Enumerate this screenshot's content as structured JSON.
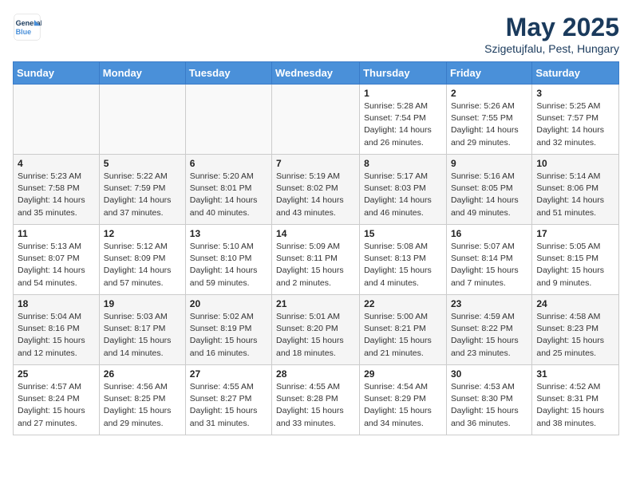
{
  "header": {
    "logo_line1": "General",
    "logo_line2": "Blue",
    "month": "May 2025",
    "location": "Szigetujfalu, Pest, Hungary"
  },
  "days_of_week": [
    "Sunday",
    "Monday",
    "Tuesday",
    "Wednesday",
    "Thursday",
    "Friday",
    "Saturday"
  ],
  "weeks": [
    [
      {
        "day": "",
        "info": ""
      },
      {
        "day": "",
        "info": ""
      },
      {
        "day": "",
        "info": ""
      },
      {
        "day": "",
        "info": ""
      },
      {
        "day": "1",
        "info": "Sunrise: 5:28 AM\nSunset: 7:54 PM\nDaylight: 14 hours\nand 26 minutes."
      },
      {
        "day": "2",
        "info": "Sunrise: 5:26 AM\nSunset: 7:55 PM\nDaylight: 14 hours\nand 29 minutes."
      },
      {
        "day": "3",
        "info": "Sunrise: 5:25 AM\nSunset: 7:57 PM\nDaylight: 14 hours\nand 32 minutes."
      }
    ],
    [
      {
        "day": "4",
        "info": "Sunrise: 5:23 AM\nSunset: 7:58 PM\nDaylight: 14 hours\nand 35 minutes."
      },
      {
        "day": "5",
        "info": "Sunrise: 5:22 AM\nSunset: 7:59 PM\nDaylight: 14 hours\nand 37 minutes."
      },
      {
        "day": "6",
        "info": "Sunrise: 5:20 AM\nSunset: 8:01 PM\nDaylight: 14 hours\nand 40 minutes."
      },
      {
        "day": "7",
        "info": "Sunrise: 5:19 AM\nSunset: 8:02 PM\nDaylight: 14 hours\nand 43 minutes."
      },
      {
        "day": "8",
        "info": "Sunrise: 5:17 AM\nSunset: 8:03 PM\nDaylight: 14 hours\nand 46 minutes."
      },
      {
        "day": "9",
        "info": "Sunrise: 5:16 AM\nSunset: 8:05 PM\nDaylight: 14 hours\nand 49 minutes."
      },
      {
        "day": "10",
        "info": "Sunrise: 5:14 AM\nSunset: 8:06 PM\nDaylight: 14 hours\nand 51 minutes."
      }
    ],
    [
      {
        "day": "11",
        "info": "Sunrise: 5:13 AM\nSunset: 8:07 PM\nDaylight: 14 hours\nand 54 minutes."
      },
      {
        "day": "12",
        "info": "Sunrise: 5:12 AM\nSunset: 8:09 PM\nDaylight: 14 hours\nand 57 minutes."
      },
      {
        "day": "13",
        "info": "Sunrise: 5:10 AM\nSunset: 8:10 PM\nDaylight: 14 hours\nand 59 minutes."
      },
      {
        "day": "14",
        "info": "Sunrise: 5:09 AM\nSunset: 8:11 PM\nDaylight: 15 hours\nand 2 minutes."
      },
      {
        "day": "15",
        "info": "Sunrise: 5:08 AM\nSunset: 8:13 PM\nDaylight: 15 hours\nand 4 minutes."
      },
      {
        "day": "16",
        "info": "Sunrise: 5:07 AM\nSunset: 8:14 PM\nDaylight: 15 hours\nand 7 minutes."
      },
      {
        "day": "17",
        "info": "Sunrise: 5:05 AM\nSunset: 8:15 PM\nDaylight: 15 hours\nand 9 minutes."
      }
    ],
    [
      {
        "day": "18",
        "info": "Sunrise: 5:04 AM\nSunset: 8:16 PM\nDaylight: 15 hours\nand 12 minutes."
      },
      {
        "day": "19",
        "info": "Sunrise: 5:03 AM\nSunset: 8:17 PM\nDaylight: 15 hours\nand 14 minutes."
      },
      {
        "day": "20",
        "info": "Sunrise: 5:02 AM\nSunset: 8:19 PM\nDaylight: 15 hours\nand 16 minutes."
      },
      {
        "day": "21",
        "info": "Sunrise: 5:01 AM\nSunset: 8:20 PM\nDaylight: 15 hours\nand 18 minutes."
      },
      {
        "day": "22",
        "info": "Sunrise: 5:00 AM\nSunset: 8:21 PM\nDaylight: 15 hours\nand 21 minutes."
      },
      {
        "day": "23",
        "info": "Sunrise: 4:59 AM\nSunset: 8:22 PM\nDaylight: 15 hours\nand 23 minutes."
      },
      {
        "day": "24",
        "info": "Sunrise: 4:58 AM\nSunset: 8:23 PM\nDaylight: 15 hours\nand 25 minutes."
      }
    ],
    [
      {
        "day": "25",
        "info": "Sunrise: 4:57 AM\nSunset: 8:24 PM\nDaylight: 15 hours\nand 27 minutes."
      },
      {
        "day": "26",
        "info": "Sunrise: 4:56 AM\nSunset: 8:25 PM\nDaylight: 15 hours\nand 29 minutes."
      },
      {
        "day": "27",
        "info": "Sunrise: 4:55 AM\nSunset: 8:27 PM\nDaylight: 15 hours\nand 31 minutes."
      },
      {
        "day": "28",
        "info": "Sunrise: 4:55 AM\nSunset: 8:28 PM\nDaylight: 15 hours\nand 33 minutes."
      },
      {
        "day": "29",
        "info": "Sunrise: 4:54 AM\nSunset: 8:29 PM\nDaylight: 15 hours\nand 34 minutes."
      },
      {
        "day": "30",
        "info": "Sunrise: 4:53 AM\nSunset: 8:30 PM\nDaylight: 15 hours\nand 36 minutes."
      },
      {
        "day": "31",
        "info": "Sunrise: 4:52 AM\nSunset: 8:31 PM\nDaylight: 15 hours\nand 38 minutes."
      }
    ]
  ]
}
